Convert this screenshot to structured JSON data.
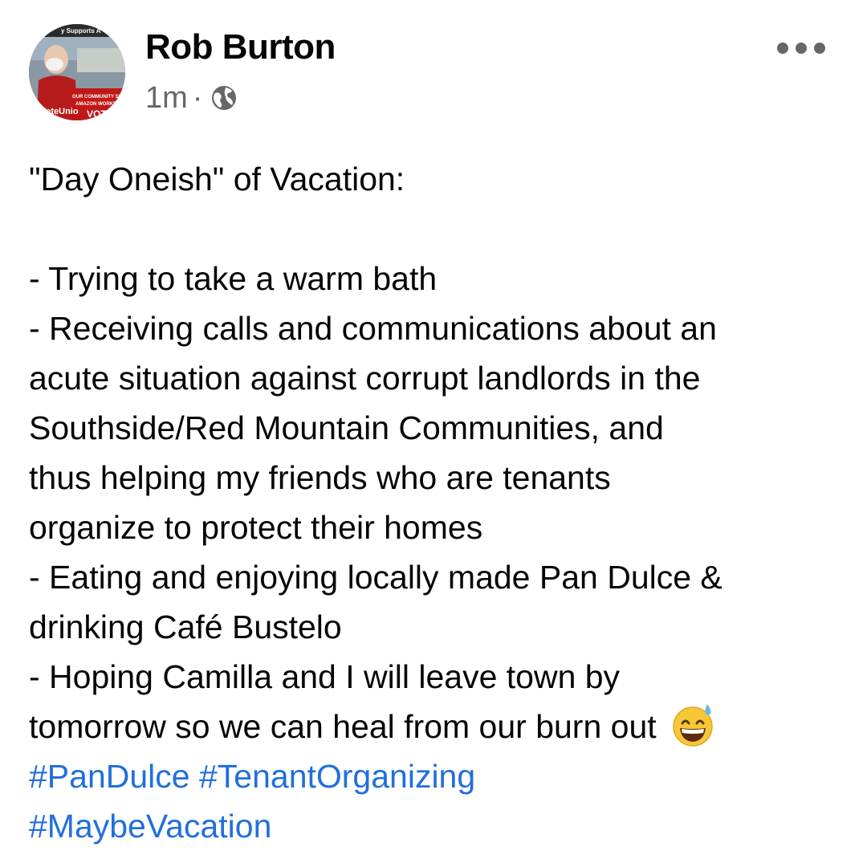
{
  "post": {
    "author": {
      "name": "Rob Burton",
      "avatar_alt": "profile photo"
    },
    "timestamp": "1m",
    "separator": "·",
    "privacy_icon": "globe-icon",
    "more_icon": "more-horizontal-icon",
    "avatar_sign": {
      "top": "y Supports A",
      "line1": "OUR COMMUNITY SUP",
      "line2": "AMAZON WORKE",
      "vote": "VOTE",
      "hashtag": "#VoteUnio"
    },
    "body": {
      "title": "\"Day Oneish\" of Vacation:",
      "lines": [
        "- Trying to take a warm bath",
        "- Receiving calls and communications about an",
        "acute situation against corrupt landlords in the",
        "Southside/Red Mountain Communities, and",
        "thus helping my friends who are tenants",
        "organize to protect their homes",
        "- Eating and enjoying locally made Pan Dulce &",
        "drinking Café Bustelo",
        "- Hoping Camilla and I will leave town by",
        "tomorrow so we can heal from our burn out"
      ],
      "emoji": "grinning-face-with-sweat-emoji",
      "hashtags": [
        "#PanDulce",
        "#TenantOrganizing",
        "#MaybeVacation"
      ]
    },
    "colors": {
      "text": "#050505",
      "secondary": "#65676b",
      "link": "#216fdb",
      "background": "#ffffff"
    }
  }
}
